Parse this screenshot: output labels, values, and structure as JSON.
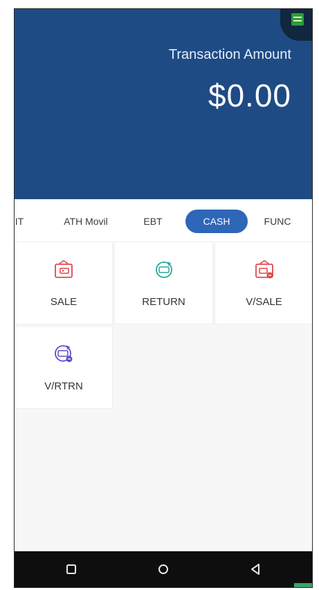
{
  "header": {
    "amount_label": "Transaction Amount",
    "amount_value": "$0.00",
    "status_icon": "terminal-signal-icon",
    "bg_color": "#1f4b85"
  },
  "tabs": [
    {
      "label": "IT",
      "active": false
    },
    {
      "label": "ATH Movil",
      "active": false
    },
    {
      "label": "EBT",
      "active": false
    },
    {
      "label": "CASH",
      "active": true
    },
    {
      "label": "FUNC",
      "active": false
    }
  ],
  "tiles": [
    {
      "label": "SALE",
      "icon": "wallet-icon"
    },
    {
      "label": "RETURN",
      "icon": "refund-icon"
    },
    {
      "label": "V/SALE",
      "icon": "void-sale-icon"
    },
    {
      "label": "V/RTRN",
      "icon": "void-return-icon"
    }
  ],
  "navbar": {
    "buttons": [
      "recent-apps-icon",
      "home-icon",
      "back-icon"
    ]
  },
  "colors": {
    "accent": "#2e67b8",
    "sale_icon": "#e0474c",
    "return_icon": "#2aa89a",
    "void_return_icon": "#5b4fc9"
  }
}
